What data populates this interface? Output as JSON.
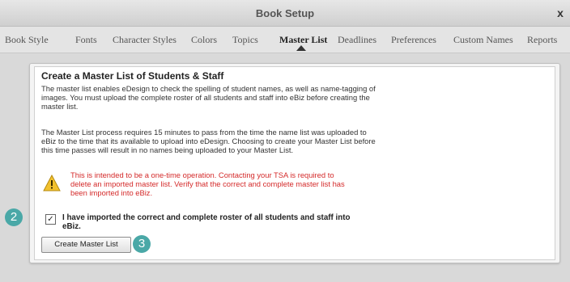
{
  "window": {
    "title": "Book Setup",
    "close_glyph": "x"
  },
  "tabs": [
    {
      "label": "Book Style"
    },
    {
      "label": "Fonts"
    },
    {
      "label": "Character Styles"
    },
    {
      "label": "Colors"
    },
    {
      "label": "Topics"
    },
    {
      "label": "Master List",
      "active": true
    },
    {
      "label": "Deadlines"
    },
    {
      "label": "Preferences"
    },
    {
      "label": "Custom Names"
    },
    {
      "label": "Reports"
    }
  ],
  "panel": {
    "heading": "Create a Master List of Students & Staff",
    "paragraph1": "The master list enables eDesign to check the spelling of student names, as well as name-tagging of images. You must upload the complete roster of all students and staff into eBiz before creating the master list.",
    "paragraph2": "The Master List process requires 15 minutes to pass from the time the name list was uploaded to eBiz to the time that its available to upload into eDesign. Choosing to create your Master List before this time passes will result in no names being uploaded to your Master List.",
    "warning": "This is intended to be a one-time operation. Contacting your TSA is required to delete an imported master list. Verify that the correct and complete master list has been imported into eBiz.",
    "warning_icon": "warning-triangle-icon",
    "checkbox_checked": true,
    "checkbox_label": "I have imported the correct and complete roster of all students and staff into eBiz.",
    "create_button": "Create Master List"
  },
  "badges": {
    "step_checkbox": "2",
    "step_button": "3",
    "color": "#4aa8a7"
  },
  "colors": {
    "warning_text": "#d42a2a",
    "warning_icon": "#f2c12e"
  }
}
